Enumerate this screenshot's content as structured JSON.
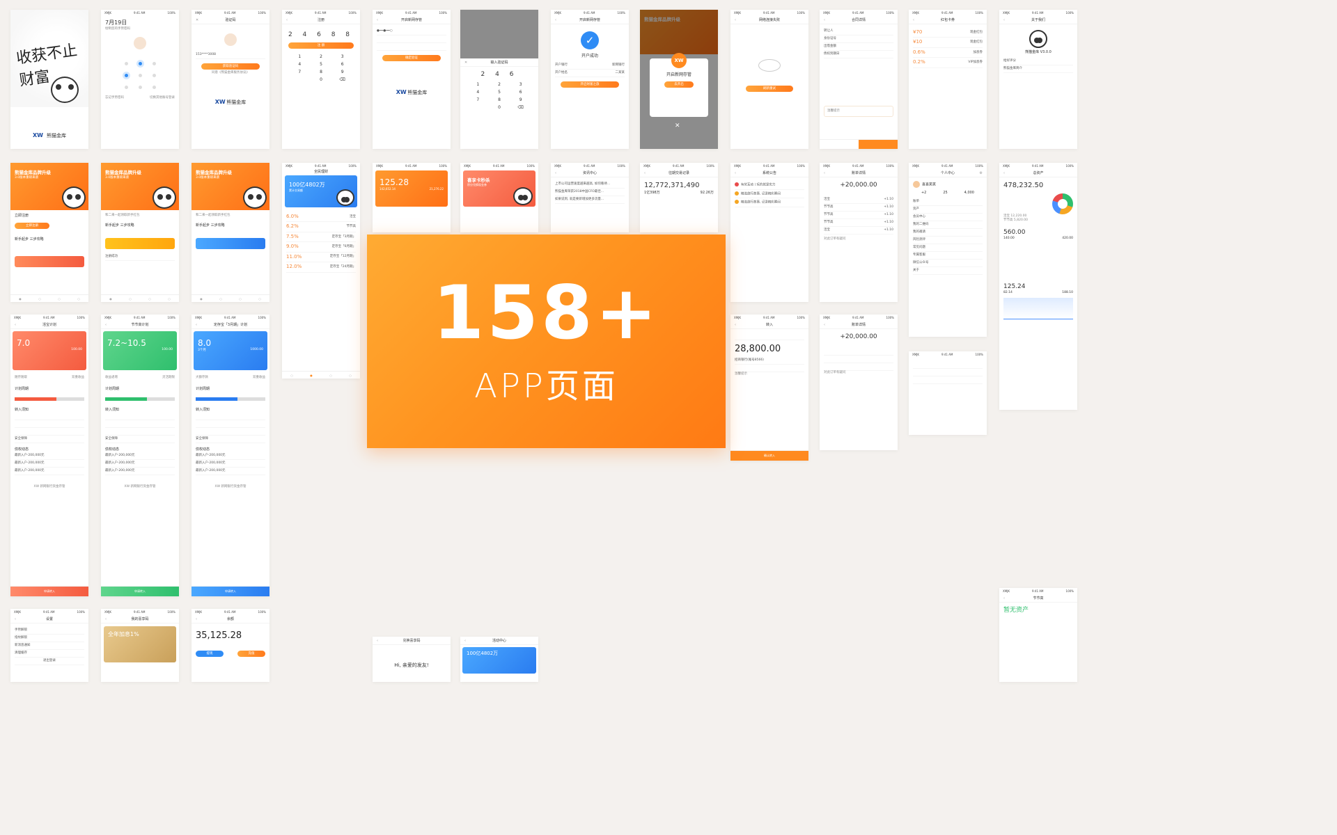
{
  "status": {
    "carrier": "XMJK",
    "time": "9:41 AM",
    "battery": "100%"
  },
  "banner": {
    "count": "158+",
    "subtitle": "APP页面"
  },
  "splash": {
    "slogan": "收获不止财富",
    "partner": "XW",
    "partner_sub": "新网银行",
    "brand": "熊猫金库",
    "brand_sub": "上市企业下属互联网金融平台"
  },
  "gesture": {
    "date": "7月19日",
    "hint": "绘制您的手势密码",
    "forgot": "忘记手势密码",
    "switch": "切换其他账号登录"
  },
  "login": {
    "title": "验证码",
    "phone": "153****3008",
    "btn": "获取验证码",
    "agree": "同意《熊猫金库服务协议》"
  },
  "register": {
    "title": "注册",
    "pin": "2 4 6 8 8",
    "btn": "注 册",
    "keys": [
      "1",
      "2",
      "3",
      "4",
      "5",
      "6",
      "7",
      "8",
      "9",
      "",
      "0",
      "⌫"
    ],
    "confirm": "确定"
  },
  "open_account": {
    "title": "开启新网存管",
    "btn": "确定验证",
    "code_title": "输入验证码",
    "pin": "2 4 6",
    "success": "开户成功",
    "done_btn": "开启财富之旅",
    "bank_label": "开户银行",
    "bank_value": "新网银行",
    "account_label": "开户姓名",
    "account_value": "二某某"
  },
  "modal": {
    "title": "熊猫金库品牌升级",
    "sub": "开启新网存管",
    "btn": "去开启"
  },
  "network_error": {
    "title": "网络连接失败",
    "btn": "刷新重试"
  },
  "contract": {
    "title": "合同详情",
    "rows": [
      "转让人",
      "身份证号",
      "出借金额",
      "债权到期日"
    ],
    "tip": "温馨提示"
  },
  "coupons": {
    "title": "红包卡券",
    "items": [
      {
        "val": "¥70",
        "name": "现金红包"
      },
      {
        "val": "¥10",
        "name": "现金红包"
      },
      {
        "val": "0.6%",
        "name": "加息券"
      },
      {
        "val": "0.2%",
        "name": "VIP加息券"
      }
    ]
  },
  "about": {
    "title": "关于我们",
    "version": "熊猫金库 V3.0.0",
    "rows": [
      "给好评分",
      "熊猫金库简介"
    ]
  },
  "home": {
    "hero_title": "熊猫金库品牌升级",
    "hero_sub": "3.0版本重磅来袭",
    "tag": "了解详情",
    "notice": "和二来一起领取新手红包",
    "guide": "新手起步 三步攻略",
    "register_btn": "立即注册",
    "steps": [
      "注册账户",
      "开通存管",
      "第一笔投资"
    ],
    "success": "注册成功"
  },
  "finance": {
    "title": "全民理财",
    "total": "100亿4802万",
    "total_sub": "累计交易额",
    "plans": [
      {
        "rate": "6.0%",
        "name": "活宝"
      },
      {
        "rate": "6.2%",
        "name": "节节高"
      },
      {
        "rate": "7.5%",
        "name": "定存宝「3月期」"
      },
      {
        "rate": "9.0%",
        "name": "定存宝「6月期」"
      },
      {
        "rate": "11.0%",
        "name": "定存宝「12月期」"
      },
      {
        "rate": "12.0%",
        "name": "定存宝「24月期」"
      }
    ]
  },
  "mine": {
    "title": "我的",
    "assets": "125.28",
    "today": "142,652.14",
    "yesterday": "21,276.22"
  },
  "discover": {
    "title": "资讯发现",
    "hero": "喜享卡秒杀",
    "hero_sub": "积分兑换现金券"
  },
  "news": {
    "title": "资讯中心",
    "items": [
      "上市公司运营速度越来越高, 如何看待...",
      "熊猫金库荣获2018中国CFO最佳...",
      "如果说到, 就是要新增加更多流量..."
    ]
  },
  "records": {
    "title": "往期交易记录",
    "total": "12,772,371,490",
    "users": "1亿398万",
    "rate": "92.26万"
  },
  "system": {
    "title": "系统公告",
    "items": [
      "有奖互动丨玩的就是实力",
      "精选旅行故事, 记录精彩瞬间",
      "精选旅行故事, 记录精彩瞬间"
    ]
  },
  "bill": {
    "title": "账单详情",
    "amount": "+20,000.00",
    "rows": [
      {
        "name": "活宝",
        "val": "+1.10"
      },
      {
        "name": "节节高",
        "val": "+1.10"
      },
      {
        "name": "节节高",
        "val": "+1.10"
      },
      {
        "name": "节节高",
        "val": "+1.10"
      },
      {
        "name": "活宝",
        "val": "+1.10"
      }
    ],
    "more": "对此订单有疑问"
  },
  "profile": {
    "title": "个人中心",
    "name": "喜喜笑笑",
    "stats": [
      {
        "n": "+2",
        "l": "红包"
      },
      {
        "n": "25",
        "l": "加息券"
      },
      {
        "n": "4,000",
        "l": "积分"
      }
    ],
    "rows": [
      "账单",
      "资产",
      "会员中心",
      "我的二维码",
      "我的邀请",
      "风险测评",
      "常见问题",
      "专属客服",
      "微信公众号",
      "关于"
    ]
  },
  "assets": {
    "title": "总资产",
    "total": "478,232.50",
    "items": [
      "活宝 12,220.00",
      "节节高 5,820.00",
      "定存宝 10,000.00",
      "红包 324,120.00"
    ],
    "yesterday": "560.00",
    "y1": "140.00",
    "y2": "420.00",
    "cum": "125.24",
    "c1": "82.14",
    "c2": "188.10"
  },
  "plan_red": {
    "title": "活宝计划",
    "rate": "7.0",
    "min": "100.00",
    "tags": [
      "随存随取",
      "双重收益"
    ]
  },
  "plan_green": {
    "title": "节节高计划",
    "rate": "7.2~10.5",
    "min": "100.00",
    "tags": [
      "收益递增",
      "灵活期限"
    ]
  },
  "plan_blue": {
    "title": "定存宝「3月期」计划",
    "rate": "8.0",
    "period": "3个月",
    "min": "1000.00",
    "tags": [
      "大额存款",
      "双重收益"
    ]
  },
  "plan_common": {
    "section": "计划周期",
    "rules": "转入须知",
    "safe": "安全保障",
    "dynamic": "债权动态",
    "apply": "申请转入",
    "list": [
      "最新入户·200,000元",
      "最新入户·200,000元",
      "最新入户·200,000元"
    ],
    "note": "XW 新网银行资金存管"
  },
  "transfer": {
    "title": "转入",
    "amount": "28,800.00",
    "bank": "招商银行(尾号8566)",
    "confirm": "确认转入",
    "tip": "温馨提示"
  },
  "apply_success": {
    "title": "申请成功",
    "steps": [
      "提出申请成功",
      "三个工作日内, 等待款项到账",
      "资金到账"
    ],
    "btn": "申请成功"
  },
  "zero": {
    "title": "节节高",
    "empty": "暂无资产"
  },
  "settings": {
    "title": "设置",
    "rows": [
      "手势解锁",
      "指纹解锁",
      "新消息通知",
      "清理缓存"
    ],
    "logout": "退出登录"
  },
  "vip": {
    "title": "我的喜享码",
    "rate": "全年加息1%"
  },
  "balance": {
    "title": "余额",
    "amount": "35,125.28",
    "in": "提现",
    "out": "充值"
  },
  "activity": {
    "title": "活动中心",
    "tabs": [
      "精选活动",
      "我的活动"
    ],
    "items": [
      "200积分兑换",
      "50元现金红包"
    ]
  },
  "invite": {
    "title": "兑换喜享码",
    "greet": "Hi, 亲爱的发友!"
  },
  "withdraw_methods": {
    "title": "选择转出方式",
    "btn": "确认转出"
  }
}
